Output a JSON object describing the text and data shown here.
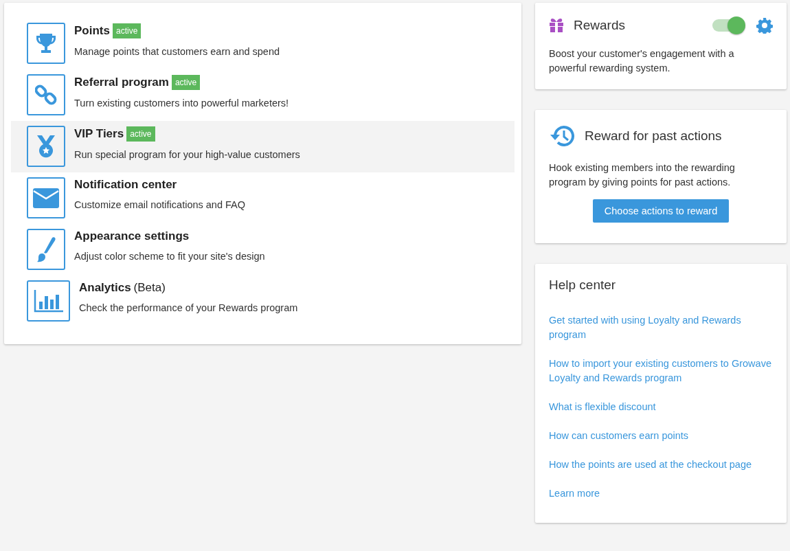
{
  "features": [
    {
      "kind": "trophy",
      "title": "Points",
      "badge": "active",
      "description": "Manage points that customers earn and spend",
      "selected": false
    },
    {
      "kind": "link",
      "title": "Referral program",
      "badge": "active",
      "description": "Turn existing customers into powerful marketers!",
      "selected": false
    },
    {
      "kind": "medal",
      "title": "VIP Tiers",
      "badge": "active",
      "description": "Run special program for your high-value customers",
      "selected": true
    },
    {
      "kind": "envelope",
      "title": "Notification center",
      "description": "Customize email notifications and FAQ",
      "selected": false
    },
    {
      "kind": "brush",
      "title": "Appearance settings",
      "description": "Adjust color scheme to fit your site's design",
      "selected": false
    },
    {
      "kind": "chart",
      "title": "Analytics",
      "suffix": "(Beta)",
      "description": "Check the performance of your Rewards program",
      "selected": false
    }
  ],
  "rewards": {
    "title": "Rewards",
    "on": true,
    "description": "Boost your customer's engagement with a powerful rewarding system."
  },
  "past_actions": {
    "title": "Reward for past actions",
    "description": "Hook existing members into the rewarding program by giving points for past actions.",
    "button": "Choose actions to reward"
  },
  "help_center": {
    "title": "Help center",
    "links": [
      "Get started with using Loyalty and Rewards program",
      "How to import your existing customers to Growave Loyalty and Rewards program",
      "What is flexible discount",
      "How can customers earn points",
      "How the points are used at the checkout page",
      "Learn more"
    ]
  }
}
